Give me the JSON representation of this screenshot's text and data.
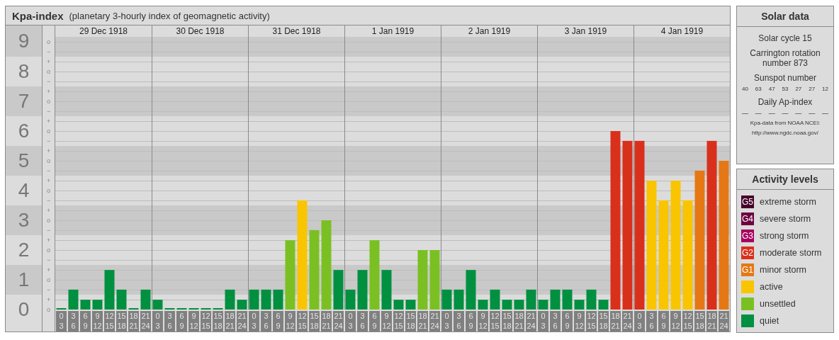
{
  "kpa_panel": {
    "title": "Kpa-index",
    "subtitle": "(planetary 3-hourly index of geomagnetic activity)",
    "sublevel_marks": [
      "o",
      "−",
      "+",
      "o",
      "−",
      "+",
      "o",
      "−",
      "+",
      "o",
      "−",
      "+",
      "o",
      "−",
      "+",
      "o",
      "−",
      "+",
      "o",
      "−",
      "+",
      "o",
      "−",
      "+",
      "o",
      "−",
      "+",
      "o"
    ],
    "dates": [
      "29 Dec 1918",
      "30 Dec 1918",
      "31 Dec 1918",
      "1 Jan 1919",
      "2 Jan 1919",
      "3 Jan 1919",
      "4 Jan 1919"
    ],
    "chart_data": {
      "type": "bar",
      "ylim": [
        0,
        9.17
      ],
      "grid": true,
      "bands": [
        {
          "axis": "y",
          "from": 0.5,
          "to": 1.5
        },
        {
          "axis": "y",
          "from": 2.5,
          "to": 3.5
        },
        {
          "axis": "y",
          "from": 4.5,
          "to": 5.5
        },
        {
          "axis": "y",
          "from": 6.5,
          "to": 7.5
        },
        {
          "axis": "y",
          "from": 8.5,
          "to": 9.5
        }
      ],
      "yticks": [
        {
          "value": 0,
          "label": "0"
        },
        {
          "value": 1,
          "label": "1"
        },
        {
          "value": 2,
          "label": "2"
        },
        {
          "value": 3,
          "label": "3"
        },
        {
          "value": 4,
          "label": "4"
        },
        {
          "value": 5,
          "label": "5"
        },
        {
          "value": 6,
          "label": "6"
        },
        {
          "value": 7,
          "label": "7"
        },
        {
          "value": 8,
          "label": "8"
        },
        {
          "value": 9,
          "label": "9"
        }
      ],
      "categories": [
        "0 3",
        "3 6",
        "6 9",
        "9 12",
        "12 15",
        "15 18",
        "18 21",
        "21 24",
        "0 3",
        "3 6",
        "6 9",
        "9 12",
        "12 15",
        "15 18",
        "18 21",
        "21 24",
        "0 3",
        "3 6",
        "6 9",
        "9 12",
        "12 15",
        "15 18",
        "18 21",
        "21 24",
        "0 3",
        "3 6",
        "6 9",
        "9 12",
        "12 15",
        "15 18",
        "18 21",
        "21 24",
        "0 3",
        "3 6",
        "6 9",
        "9 12",
        "12 15",
        "15 18",
        "18 21",
        "21 24",
        "0 3",
        "3 6",
        "6 9",
        "9 12",
        "12 15",
        "15 18",
        "18 21",
        "21 24",
        "0 3",
        "3 6",
        "6 9",
        "9 12",
        "12 15",
        "15 18",
        "18 21",
        "21 24"
      ],
      "values": [
        0,
        0.67,
        0.33,
        0.33,
        1.33,
        0.67,
        0,
        0.67,
        0.33,
        0,
        0,
        0,
        0,
        0,
        0.67,
        0.33,
        0.67,
        0.67,
        0.67,
        2.33,
        3.67,
        2.67,
        3,
        1.33,
        0.67,
        1.33,
        2.33,
        1.33,
        0.33,
        0.33,
        2,
        2,
        0.67,
        0.67,
        1.33,
        0.33,
        0.67,
        0.33,
        0.33,
        0.67,
        0.33,
        0.67,
        0.67,
        0.33,
        0.67,
        0.33,
        6,
        5.67,
        5.67,
        4.33,
        3.67,
        4.33,
        3.67,
        4.67,
        5.67,
        5
      ]
    }
  },
  "solar_data": {
    "title": "Solar data",
    "solar_cycle": "Solar cycle 15",
    "carrington": "Carrington rotation number 873",
    "sunspot_title": "Sunspot number",
    "sunspot_numbers": [
      "40",
      "63",
      "47",
      "53",
      "27",
      "27",
      "12"
    ],
    "ap_title": "Daily Ap-index",
    "ap_values": [
      "—",
      "—",
      "—",
      "—",
      "—",
      "—",
      "—"
    ],
    "source": [
      "Kpa-data from NOAA NCEI:",
      "http://www.ngdc.noaa.gov/"
    ]
  },
  "activity_levels": {
    "title": "Activity levels",
    "items": [
      {
        "badge": "G5",
        "label": "extreme storm",
        "color": "#46002a"
      },
      {
        "badge": "G4",
        "label": "severe storm",
        "color": "#6e0040"
      },
      {
        "badge": "G3",
        "label": "strong storm",
        "color": "#a8005f"
      },
      {
        "badge": "G2",
        "label": "moderate storm",
        "color": "#d9301c"
      },
      {
        "badge": "G1",
        "label": "minor storm",
        "color": "#e57814"
      },
      {
        "label": "active",
        "color": "#f9c500"
      },
      {
        "label": "unsettled",
        "color": "#7bc023"
      },
      {
        "label": "quiet",
        "color": "#009040"
      }
    ]
  }
}
